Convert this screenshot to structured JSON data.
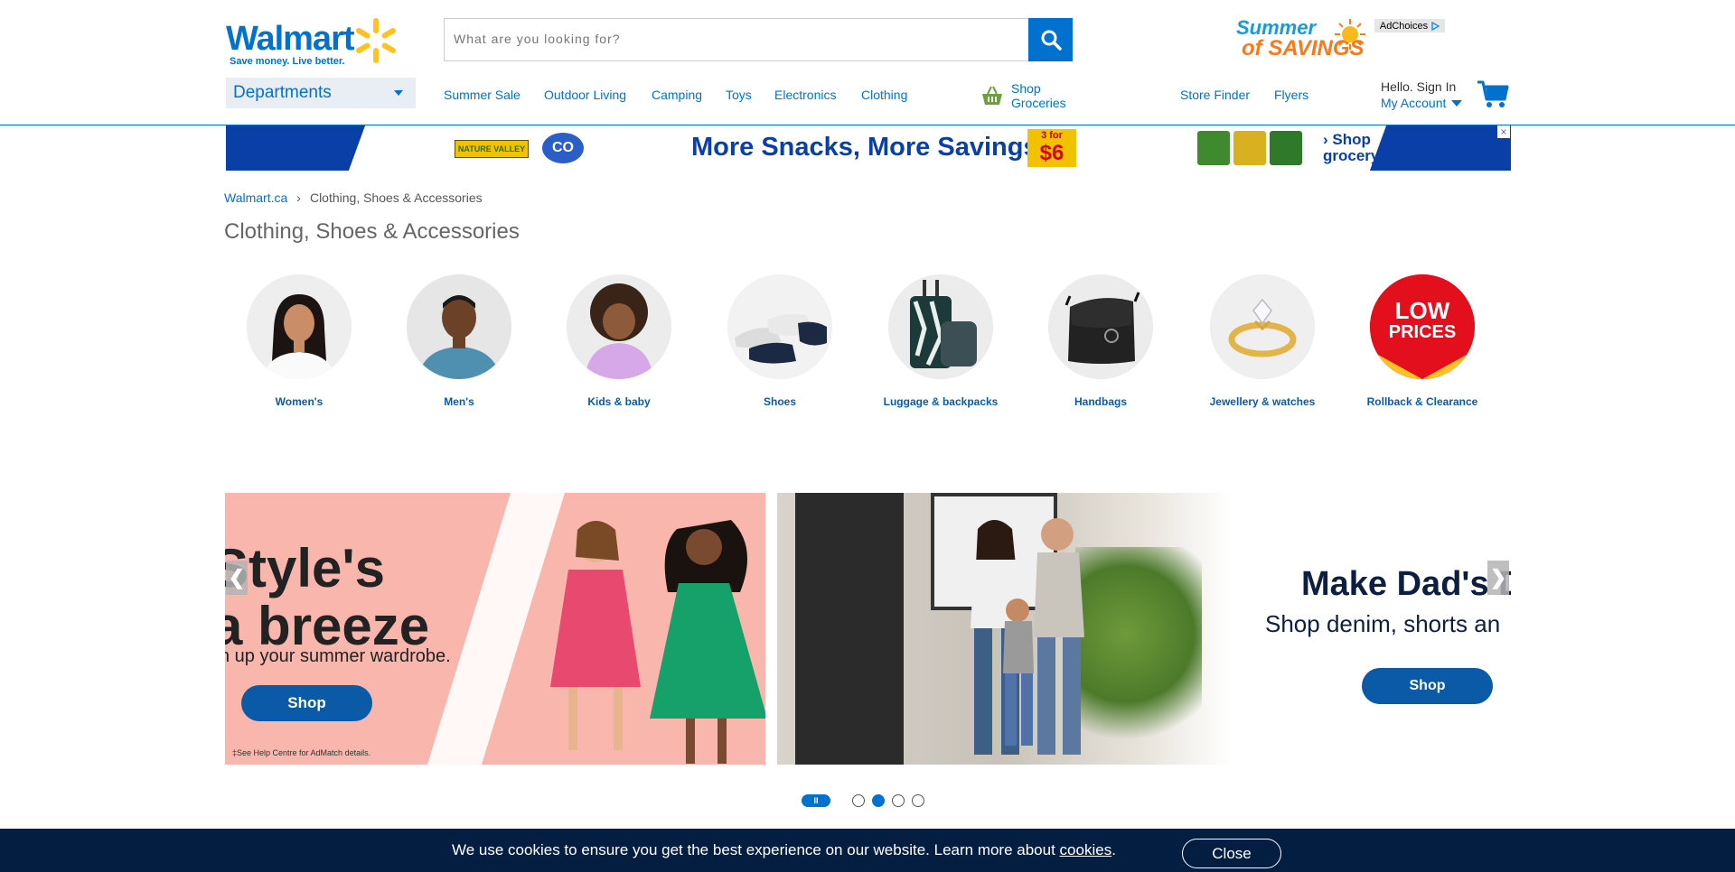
{
  "header": {
    "logo_text": "Walmart",
    "tagline": "Save money. Live better.",
    "search": {
      "placeholder": "What are you looking for?",
      "value": ""
    },
    "promo": {
      "line1": "Summer",
      "line2": "of SAVINGS"
    },
    "adchoices_label": "AdChoices",
    "departments_label": "Departments",
    "nav": [
      "Summer Sale",
      "Outdoor Living",
      "Camping",
      "Toys",
      "Electronics",
      "Clothing"
    ],
    "groceries": {
      "line1": "Shop",
      "line2": "Groceries"
    },
    "store_finder": "Store Finder",
    "flyers": "Flyers",
    "account": {
      "greeting": "Hello. Sign In",
      "label": "My Account"
    },
    "colors": {
      "brand_blue": "#0071ce",
      "spark_yellow": "#ffc220",
      "dark_navy": "#041e42"
    }
  },
  "ad_banner": {
    "brand1": "NATURE VALLEY",
    "brand2": "CO",
    "headline": "More Snacks, More Savings!",
    "price_top": "3 for",
    "price_value": "$6",
    "cta_line1": "› Shop",
    "cta_line2": "grocery",
    "close": "×"
  },
  "breadcrumb": {
    "home": "Walmart.ca",
    "separator": "›",
    "current": "Clothing, Shoes & Accessories"
  },
  "page_title": "Clothing, Shoes & Accessories",
  "categories": [
    {
      "label": "Women's"
    },
    {
      "label": "Men's"
    },
    {
      "label": "Kids & baby"
    },
    {
      "label": "Shoes"
    },
    {
      "label": "Luggage & backpacks"
    },
    {
      "label": "Handbags"
    },
    {
      "label": "Jewellery & watches"
    },
    {
      "label": "Rollback & Clearance",
      "badge_line1": "LOW",
      "badge_line2": "PRICES"
    }
  ],
  "carousel": {
    "slide1": {
      "line1": "Style's",
      "line2": "a breeze",
      "sub": "n up your summer wardrobe.",
      "button": "Shop",
      "fine_print": "‡See Help Centre for AdMatch details."
    },
    "slide2": {
      "headline": "Make Dad's D",
      "sub": "Shop denim, shorts an",
      "button": "Shop"
    },
    "prev": "❮",
    "next": "❯",
    "pause": "II",
    "dots": 4,
    "active_dot": 2
  },
  "cookie_bar": {
    "text": "We use cookies to ensure you get the best experience on our website. Learn more about ",
    "link": "cookies",
    "end": ".",
    "close": "Close"
  }
}
